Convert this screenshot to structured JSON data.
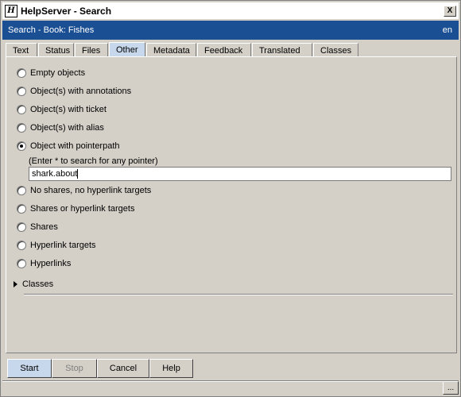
{
  "window": {
    "title": "HelpServer - Search",
    "app_icon": "H",
    "close_label": "X"
  },
  "header": {
    "breadcrumb": "Search - Book: Fishes",
    "language": "en"
  },
  "tabs": [
    {
      "label": "Text",
      "active": false
    },
    {
      "label": "Status",
      "active": false
    },
    {
      "label": "Files",
      "active": false
    },
    {
      "label": "Other",
      "active": true
    },
    {
      "label": "Metadata",
      "active": false
    },
    {
      "label": "Feedback",
      "active": false
    },
    {
      "label": "Translated",
      "active": false
    },
    {
      "label": "Classes",
      "active": false
    }
  ],
  "options": {
    "empty_objects": "Empty objects",
    "with_annotations": "Object(s) with annotations",
    "with_ticket": "Object(s) with ticket",
    "with_alias": "Object(s) with alias",
    "with_pointerpath": "Object with pointerpath",
    "no_shares": "No shares, no hyperlink targets",
    "shares_or_targets": "Shares or hyperlink targets",
    "shares": "Shares",
    "hyperlink_targets": "Hyperlink targets",
    "hyperlinks": "Hyperlinks",
    "selected": "with_pointerpath"
  },
  "pointerpath": {
    "hint": "(Enter * to search for any pointer)",
    "value": "shark.about"
  },
  "classes_section": {
    "label": "Classes"
  },
  "buttons": {
    "start": "Start",
    "stop": "Stop",
    "cancel": "Cancel",
    "help": "Help"
  },
  "statusbar": {
    "more_label": "..."
  },
  "colors": {
    "header_bg": "#1b4f93",
    "active_tab_bg": "#c8d8ec",
    "window_bg": "#d4d0c8"
  }
}
